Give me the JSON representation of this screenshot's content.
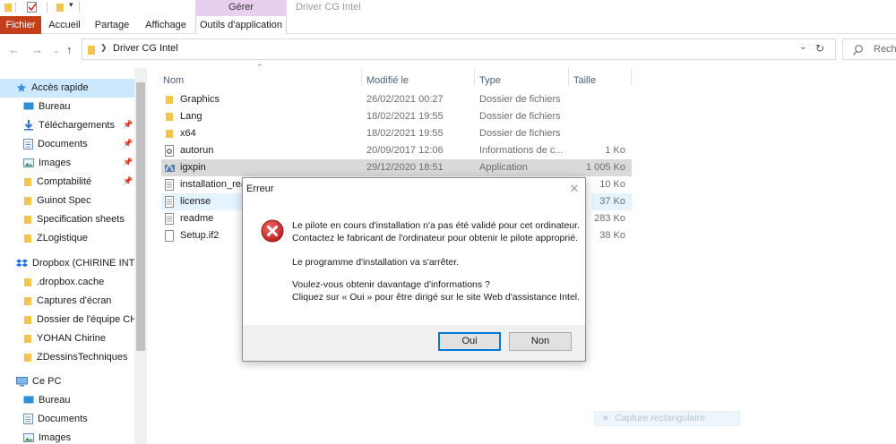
{
  "window": {
    "title": "Driver CG Intel",
    "context_group": "Gérer"
  },
  "ribbon": {
    "tabs": [
      {
        "label": "Fichier"
      },
      {
        "label": "Accueil"
      },
      {
        "label": "Partage"
      },
      {
        "label": "Affichage"
      },
      {
        "label": "Outils d'application"
      }
    ]
  },
  "address": {
    "path": "Driver CG Intel",
    "search_placeholder": "Reche"
  },
  "navigation": {
    "quick_access_label": "Accès rapide",
    "quick_items": [
      {
        "label": "Bureau",
        "icon": "desktop-icon",
        "pinned": true
      },
      {
        "label": "Téléchargements",
        "icon": "download-icon",
        "pinned": true
      },
      {
        "label": "Documents",
        "icon": "documents-icon",
        "pinned": true
      },
      {
        "label": "Images",
        "icon": "images-icon",
        "pinned": true
      },
      {
        "label": "Comptabilité",
        "icon": "folder-icon",
        "pinned": false
      },
      {
        "label": "Guinot Spec",
        "icon": "folder-icon",
        "pinned": false
      },
      {
        "label": "Specification sheets",
        "icon": "folder-icon",
        "pinned": false
      },
      {
        "label": "ZLogistique",
        "icon": "folder-icon",
        "pinned": false
      }
    ],
    "dropbox_label": "Dropbox (CHIRINE INT'L)",
    "dropbox_items": [
      {
        "label": ".dropbox.cache"
      },
      {
        "label": "Captures d'écran"
      },
      {
        "label": "Dossier de l'équipe CHI"
      },
      {
        "label": "YOHAN Chirine"
      },
      {
        "label": "ZDessinsTechniques"
      }
    ],
    "pc_label": "Ce PC",
    "pc_items": [
      {
        "label": "Bureau",
        "icon": "desktop-icon"
      },
      {
        "label": "Documents",
        "icon": "documents-icon"
      },
      {
        "label": "Images",
        "icon": "images-icon"
      }
    ]
  },
  "columns": {
    "name": "Nom",
    "modified": "Modifié le",
    "type": "Type",
    "size": "Taille"
  },
  "files": [
    {
      "name": "Graphics",
      "modified": "26/02/2021 00:27",
      "type": "Dossier de fichiers",
      "size": "",
      "icon": "folder-icon"
    },
    {
      "name": "Lang",
      "modified": "18/02/2021 19:55",
      "type": "Dossier de fichiers",
      "size": "",
      "icon": "folder-icon"
    },
    {
      "name": "x64",
      "modified": "18/02/2021 19:55",
      "type": "Dossier de fichiers",
      "size": "",
      "icon": "folder-icon"
    },
    {
      "name": "autorun",
      "modified": "20/09/2017 12:06",
      "type": "Informations de c...",
      "size": "1 Ko",
      "icon": "settings-file-icon"
    },
    {
      "name": "igxpin",
      "modified": "29/12/2020 18:51",
      "type": "Application",
      "size": "1 005 Ko",
      "icon": "application-icon",
      "selected": true
    },
    {
      "name": "installation_rea",
      "modified": "",
      "type": "",
      "size": "10 Ko",
      "icon": "text-file-icon"
    },
    {
      "name": "license",
      "modified": "",
      "type": "",
      "size": "37 Ko",
      "icon": "text-file-icon",
      "highlight": true
    },
    {
      "name": "readme",
      "modified": "",
      "type": "",
      "size": "283 Ko",
      "icon": "text-file-icon"
    },
    {
      "name": "Setup.if2",
      "modified": "",
      "type": "",
      "size": "38 Ko",
      "icon": "blank-file-icon"
    }
  ],
  "dialog": {
    "title": "Erreur",
    "line1": "Le pilote en cours d'installation n'a pas été validé pour cet ordinateur.",
    "line2": "Contactez le fabricant de l'ordinateur pour obtenir le pilote approprié.",
    "line3": "Le programme d'installation va s'arrêter.",
    "line4": "Voulez-vous obtenir davantage d'informations ?",
    "line5": "Cliquez sur « Oui » pour être dirigé sur le site Web d'assistance Intel.",
    "yes": "Oui",
    "no": "Non"
  },
  "ghost_tooltip": "Capture rectangulaire"
}
